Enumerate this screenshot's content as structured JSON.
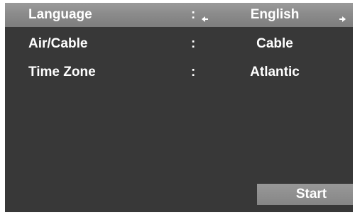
{
  "settings": {
    "rows": [
      {
        "label": "Language",
        "separator": ":",
        "value": "English"
      },
      {
        "label": "Air/Cable",
        "separator": ":",
        "value": "Cable"
      },
      {
        "label": "Time Zone",
        "separator": ":",
        "value": "Atlantic"
      }
    ]
  },
  "actions": {
    "start_label": "Start"
  },
  "colors": {
    "background": "#383838",
    "highlight": "#8a8a8a",
    "text": "#ffffff"
  },
  "icons": {
    "left": "arrow-left-icon",
    "right": "arrow-right-icon"
  }
}
